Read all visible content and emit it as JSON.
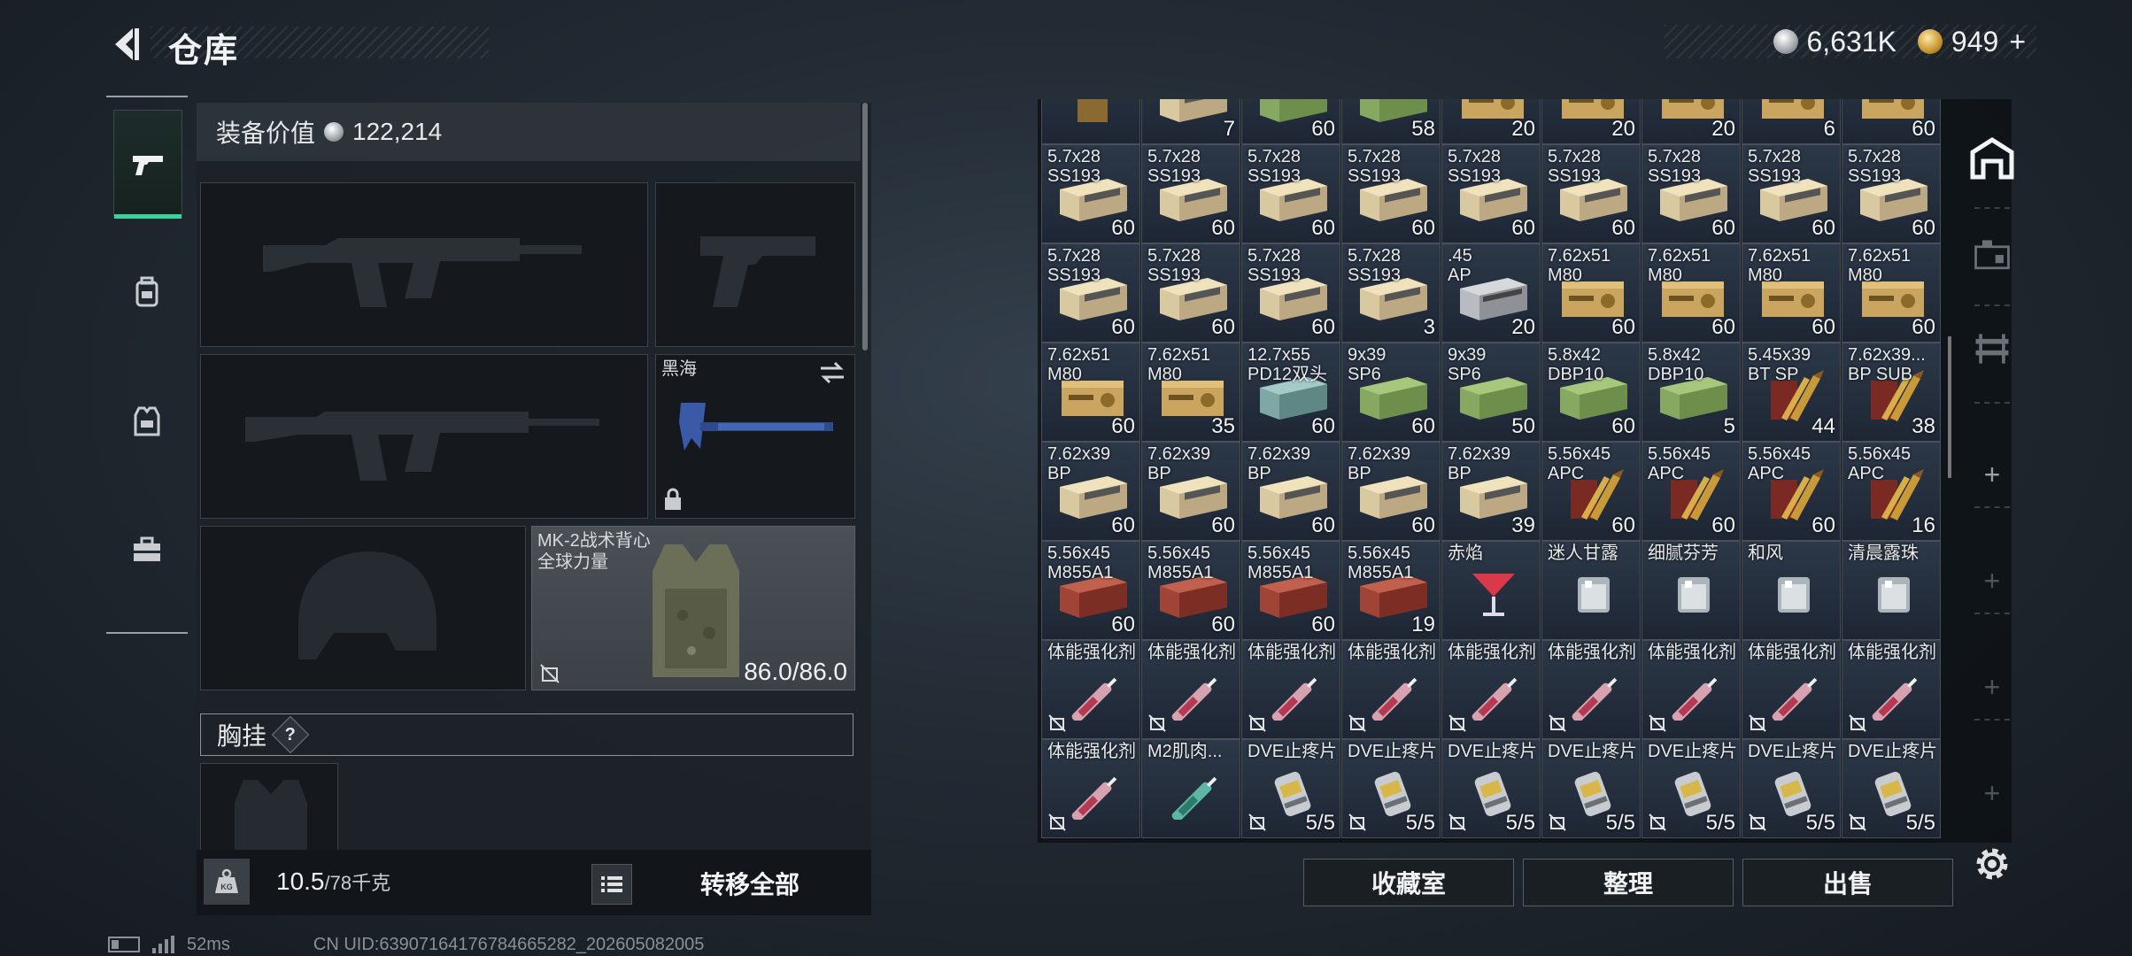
{
  "header": {
    "title": "仓库"
  },
  "currency": {
    "silver": "6,631K",
    "gold": "949",
    "gold_suffix": "+"
  },
  "nav": {
    "items": [
      "weapons-tab",
      "backpack-tab",
      "vest-tab",
      "case-tab"
    ],
    "active": "weapons-tab"
  },
  "loadout": {
    "equip_value_label": "装备价值",
    "equip_value": "122,214",
    "melee_name": "黑海",
    "vest_name": "MK-2战术背心",
    "vest_brand": "全球力量",
    "vest_durability": "86.0/86.0",
    "chest_label": "胸挂",
    "chest_help": "?",
    "weight_value": "10.5",
    "weight_max": "/78千克",
    "weight_icon_text": "KG",
    "transfer_all": "转移全部"
  },
  "storage": {
    "rows": [
      [
        {
          "n": "",
          "c": "",
          "t": "drink"
        },
        {
          "n": "",
          "c": "7",
          "t": "box"
        },
        {
          "n": "",
          "c": "60",
          "t": "green"
        },
        {
          "n": "",
          "c": "58",
          "t": "green"
        },
        {
          "n": "",
          "c": "20",
          "t": "tan"
        },
        {
          "n": "",
          "c": "20",
          "t": "tan"
        },
        {
          "n": "",
          "c": "20",
          "t": "tan"
        },
        {
          "n": "",
          "c": "6",
          "t": "tan"
        },
        {
          "n": "",
          "c": "60",
          "t": "tan"
        }
      ],
      [
        {
          "n": "5.7x28\nSS193",
          "c": "60",
          "t": "box"
        },
        {
          "n": "5.7x28\nSS193",
          "c": "60",
          "t": "box"
        },
        {
          "n": "5.7x28\nSS193",
          "c": "60",
          "t": "box"
        },
        {
          "n": "5.7x28\nSS193",
          "c": "60",
          "t": "box"
        },
        {
          "n": "5.7x28\nSS193",
          "c": "60",
          "t": "box"
        },
        {
          "n": "5.7x28\nSS193",
          "c": "60",
          "t": "box"
        },
        {
          "n": "5.7x28\nSS193",
          "c": "60",
          "t": "box"
        },
        {
          "n": "5.7x28\nSS193",
          "c": "60",
          "t": "box"
        },
        {
          "n": "5.7x28\nSS193",
          "c": "60",
          "t": "box"
        }
      ],
      [
        {
          "n": "5.7x28\nSS193",
          "c": "60",
          "t": "box"
        },
        {
          "n": "5.7x28\nSS193",
          "c": "60",
          "t": "box"
        },
        {
          "n": "5.7x28\nSS193",
          "c": "60",
          "t": "box"
        },
        {
          "n": "5.7x28\nSS193",
          "c": "3",
          "t": "box"
        },
        {
          "n": ".45\nAP",
          "c": "20",
          "t": "gray"
        },
        {
          "n": "7.62x51\nM80",
          "c": "60",
          "t": "tan"
        },
        {
          "n": "7.62x51\nM80",
          "c": "60",
          "t": "tan"
        },
        {
          "n": "7.62x51\nM80",
          "c": "60",
          "t": "tan"
        },
        {
          "n": "7.62x51\nM80",
          "c": "60",
          "t": "tan"
        }
      ],
      [
        {
          "n": "7.62x51\nM80",
          "c": "60",
          "t": "tan"
        },
        {
          "n": "7.62x51\nM80",
          "c": "35",
          "t": "tan"
        },
        {
          "n": "12.7x55\nPD12双头",
          "c": "60",
          "t": "teal"
        },
        {
          "n": "9x39\nSP6",
          "c": "60",
          "t": "green"
        },
        {
          "n": "9x39\nSP6",
          "c": "50",
          "t": "green"
        },
        {
          "n": "5.8x42\nDBP10",
          "c": "60",
          "t": "green"
        },
        {
          "n": "5.8x42\nDBP10",
          "c": "5",
          "t": "green"
        },
        {
          "n": "5.45x39\nBT SP",
          "c": "44",
          "t": "rounds"
        },
        {
          "n": "7.62x39...\nBP SUB",
          "c": "38",
          "t": "rounds"
        }
      ],
      [
        {
          "n": "7.62x39\nBP",
          "c": "60",
          "t": "box"
        },
        {
          "n": "7.62x39\nBP",
          "c": "60",
          "t": "box"
        },
        {
          "n": "7.62x39\nBP",
          "c": "60",
          "t": "box"
        },
        {
          "n": "7.62x39\nBP",
          "c": "60",
          "t": "box"
        },
        {
          "n": "7.62x39\nBP",
          "c": "39",
          "t": "box"
        },
        {
          "n": "5.56x45\nAPC",
          "c": "60",
          "t": "rounds"
        },
        {
          "n": "5.56x45\nAPC",
          "c": "60",
          "t": "rounds"
        },
        {
          "n": "5.56x45\nAPC",
          "c": "60",
          "t": "rounds"
        },
        {
          "n": "5.56x45\nAPC",
          "c": "16",
          "t": "rounds"
        }
      ],
      [
        {
          "n": "5.56x45\nM855A1",
          "c": "60",
          "t": "red"
        },
        {
          "n": "5.56x45\nM855A1",
          "c": "60",
          "t": "red"
        },
        {
          "n": "5.56x45\nM855A1",
          "c": "60",
          "t": "red"
        },
        {
          "n": "5.56x45\nM855A1",
          "c": "19",
          "t": "red"
        },
        {
          "n": "赤焰",
          "c": "",
          "t": "cocktail"
        },
        {
          "n": "迷人甘露",
          "c": "",
          "t": "glass"
        },
        {
          "n": "细腻芬芳",
          "c": "",
          "t": "glass"
        },
        {
          "n": "和风",
          "c": "",
          "t": "glass"
        },
        {
          "n": "清晨露珠",
          "c": "",
          "t": "glass"
        }
      ],
      [
        {
          "n": "体能强化剂",
          "c": "",
          "t": "syringe",
          "na": true
        },
        {
          "n": "体能强化剂",
          "c": "",
          "t": "syringe",
          "na": true
        },
        {
          "n": "体能强化剂",
          "c": "",
          "t": "syringe",
          "na": true
        },
        {
          "n": "体能强化剂",
          "c": "",
          "t": "syringe",
          "na": true
        },
        {
          "n": "体能强化剂",
          "c": "",
          "t": "syringe",
          "na": true
        },
        {
          "n": "体能强化剂",
          "c": "",
          "t": "syringe",
          "na": true
        },
        {
          "n": "体能强化剂",
          "c": "",
          "t": "syringe",
          "na": true
        },
        {
          "n": "体能强化剂",
          "c": "",
          "t": "syringe",
          "na": true
        },
        {
          "n": "体能强化剂",
          "c": "",
          "t": "syringe",
          "na": true
        }
      ],
      [
        {
          "n": "体能强化剂",
          "c": "",
          "t": "syringe",
          "na": true
        },
        {
          "n": "M2肌肉...",
          "c": "",
          "t": "syringe2"
        },
        {
          "n": "DVE止疼片",
          "c": "5/5",
          "t": "pill",
          "na": true
        },
        {
          "n": "DVE止疼片",
          "c": "5/5",
          "t": "pill",
          "na": true
        },
        {
          "n": "DVE止疼片",
          "c": "5/5",
          "t": "pill",
          "na": true
        },
        {
          "n": "DVE止疼片",
          "c": "5/5",
          "t": "pill",
          "na": true
        },
        {
          "n": "DVE止疼片",
          "c": "5/5",
          "t": "pill",
          "na": true
        },
        {
          "n": "DVE止疼片",
          "c": "5/5",
          "t": "pill",
          "na": true
        },
        {
          "n": "DVE止疼片",
          "c": "5/5",
          "t": "pill",
          "na": true
        }
      ]
    ],
    "buttons": {
      "collection": "收藏室",
      "sort": "整理",
      "sell": "出售"
    }
  },
  "footer": {
    "ping": "52ms",
    "uid": "CN UID:639071641767846652​82_202605082005"
  }
}
